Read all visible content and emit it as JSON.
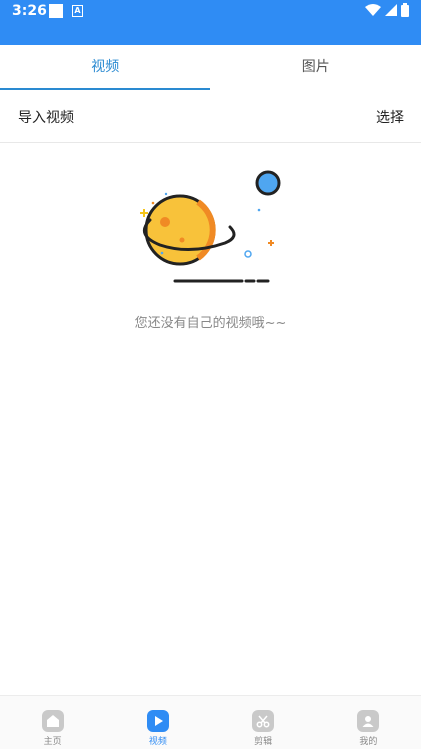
{
  "status_bar": {
    "time": "3:26",
    "a_glyph": "A",
    "icons": [
      "notification-square-icon",
      "a-icon",
      "wifi-icon",
      "signal-icon",
      "battery-icon"
    ]
  },
  "tabs": [
    {
      "label": "视频",
      "active": true
    },
    {
      "label": "图片",
      "active": false
    }
  ],
  "header": {
    "import_label": "导入视频",
    "select_label": "选择"
  },
  "empty_state": {
    "message": "您还没有自己的视频哦~~",
    "icon": "planet-icon"
  },
  "bottom_nav": [
    {
      "label": "主页",
      "icon": "home-icon",
      "active": false
    },
    {
      "label": "视频",
      "icon": "play-icon",
      "active": true
    },
    {
      "label": "剪辑",
      "icon": "scissors-icon",
      "active": false
    },
    {
      "label": "我的",
      "icon": "user-icon",
      "active": false
    }
  ],
  "colors": {
    "accent": "#2f8cf4",
    "tab_active": "#2a8ad1",
    "text_muted": "#888888"
  }
}
